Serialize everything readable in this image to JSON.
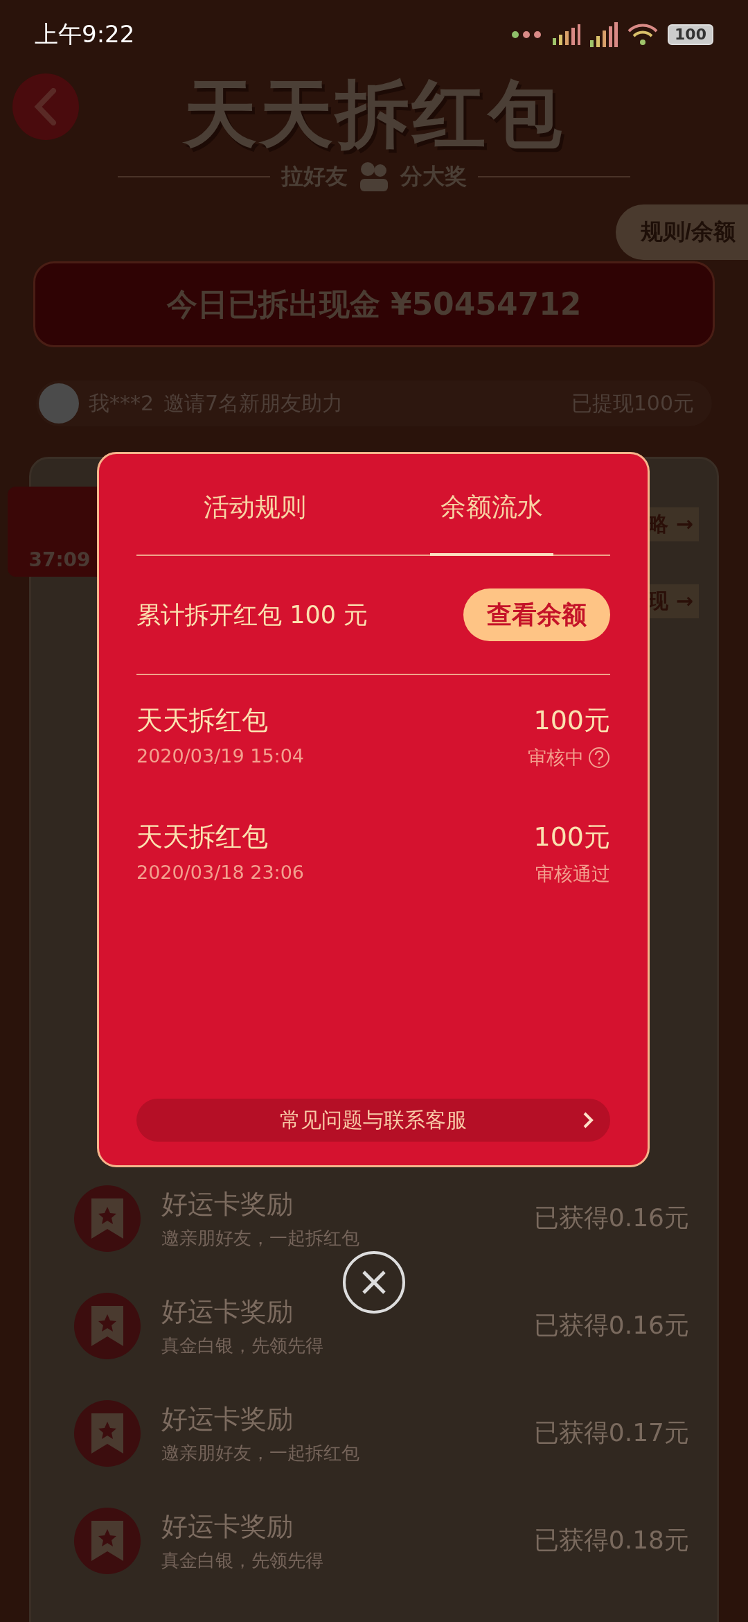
{
  "status_bar": {
    "time": "上午9:22",
    "battery": "100"
  },
  "header": {
    "title": "天天拆红包",
    "subtitle_left": "拉好友",
    "subtitle_right": "分大奖",
    "rules_button": "规则/余额"
  },
  "banner": {
    "text": "今日已拆出现金 ¥50454712"
  },
  "ticker": {
    "user": "我***2",
    "message": "邀请7名新朋友助力",
    "amount": "已提现100元"
  },
  "background_card": {
    "timer": "37:09",
    "links": [
      {
        "label": "略 →"
      },
      {
        "label": "现 →"
      }
    ],
    "rewards": [
      {
        "title": "好运卡奖励",
        "subtitle": "邀亲朋好友，一起拆红包",
        "amount": "已获得0.16元"
      },
      {
        "title": "好运卡奖励",
        "subtitle": "真金白银，先领先得",
        "amount": "已获得0.16元"
      },
      {
        "title": "好运卡奖励",
        "subtitle": "邀亲朋好友，一起拆红包",
        "amount": "已获得0.17元"
      },
      {
        "title": "好运卡奖励",
        "subtitle": "真金白银，先领先得",
        "amount": "已获得0.18元"
      }
    ]
  },
  "modal": {
    "tabs": [
      {
        "label": "活动规则",
        "selected": false
      },
      {
        "label": "余额流水",
        "selected": true
      }
    ],
    "summary": {
      "text": "累计拆开红包 100 元",
      "button": "查看余额"
    },
    "records": [
      {
        "kind": "pending",
        "title": "天天拆红包",
        "date": "2020/03/19 15:04",
        "amount": "100元",
        "status": "审核中"
      },
      {
        "kind": "approved",
        "title": "天天拆红包",
        "date": "2020/03/18 23:06",
        "amount": "100元",
        "status": "审核通过"
      }
    ],
    "help_button": "常见问题与联系客服"
  }
}
